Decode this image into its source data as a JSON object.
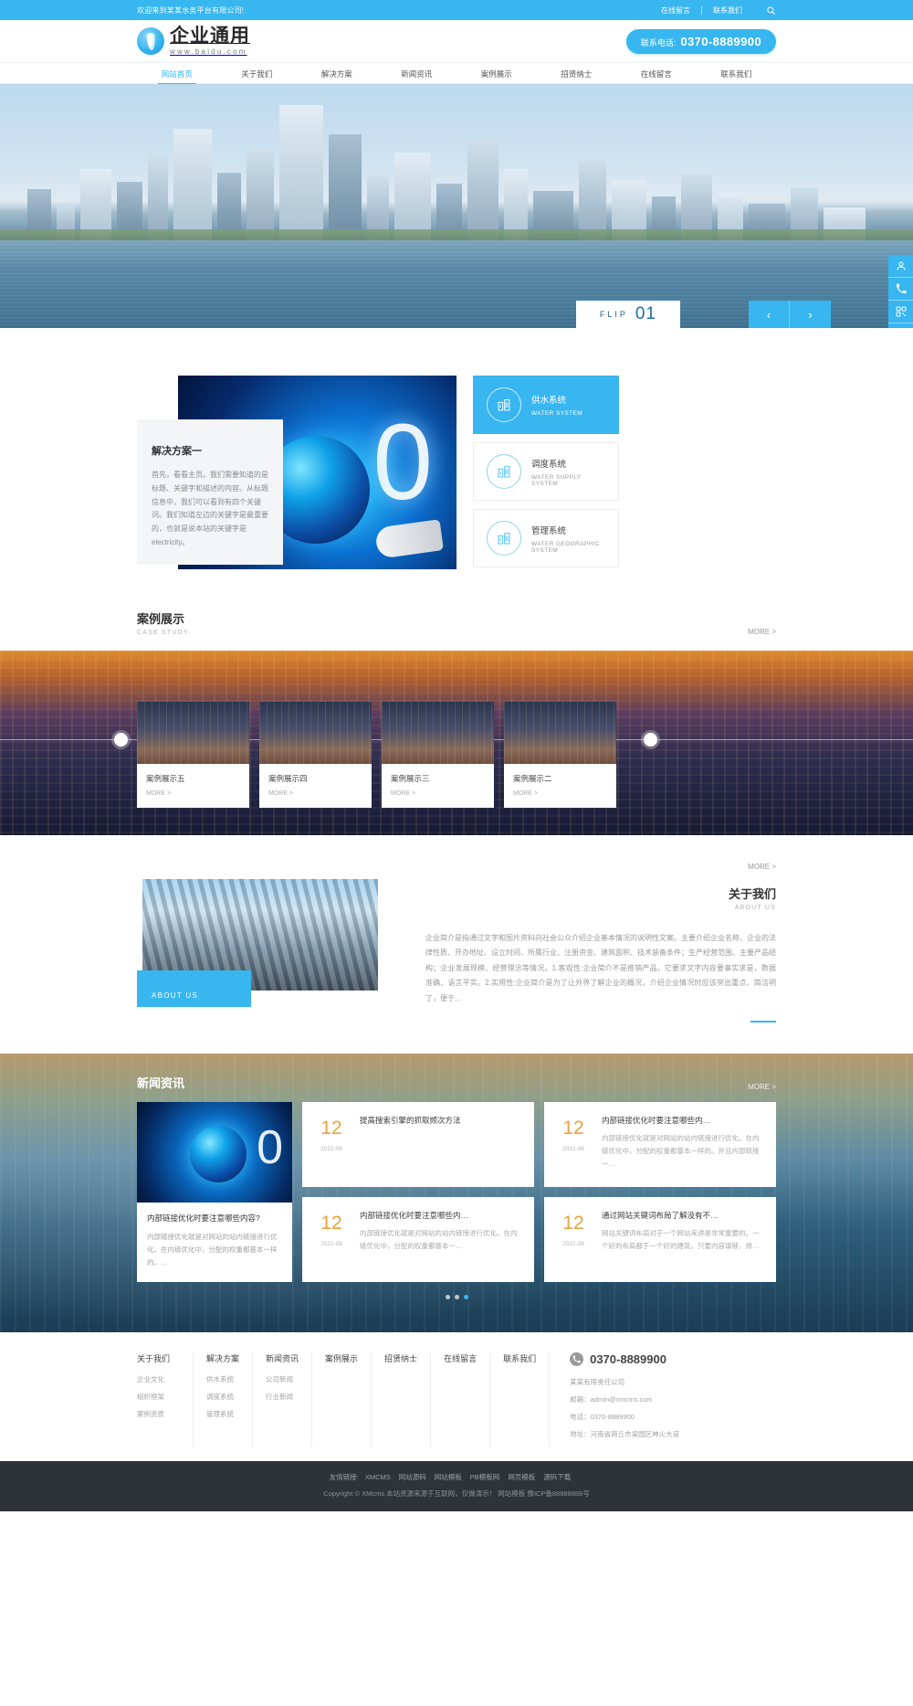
{
  "colors": {
    "accent": "#37b6ef",
    "orange": "#e8a33a",
    "footer_bg": "#2d3338"
  },
  "topbar": {
    "welcome": "欢迎来到某某水务平台有限公司!",
    "link_message": "在线留言",
    "link_contact": "联系我们",
    "search_icon": "search-icon"
  },
  "header": {
    "logo_cn": "企业通用",
    "logo_en": "www.baidu.com",
    "tel_label": "联系电话:",
    "tel_number": "0370-8889900"
  },
  "nav": {
    "items": [
      {
        "label": "网站首页",
        "active": true
      },
      {
        "label": "关于我们",
        "active": false
      },
      {
        "label": "解决方案",
        "active": false
      },
      {
        "label": "新闻资讯",
        "active": false
      },
      {
        "label": "案例展示",
        "active": false
      },
      {
        "label": "招贤纳士",
        "active": false
      },
      {
        "label": "在线留言",
        "active": false
      },
      {
        "label": "联系我们",
        "active": false
      }
    ]
  },
  "banner": {
    "flip_word": "FLIP",
    "flip_num": "01",
    "prev": "‹",
    "next": "›"
  },
  "rail": {
    "items": [
      {
        "icon": "user-service-icon"
      },
      {
        "icon": "phone-icon"
      },
      {
        "icon": "qrcode-icon"
      },
      {
        "icon": "back-to-top-icon"
      }
    ]
  },
  "solution": {
    "card_title": "解决方案一",
    "card_text": "首先，看看主页。我们需要知道的是标题、关键字和描述的内容。从标题信息中，我们可以看到有四个关键词。我们知道左边的关键字是最重要的，也就是说本站的关键字是electricity。",
    "items": [
      {
        "name": "供水系统",
        "en": "WATER SYSTEM",
        "active": true,
        "icon": "building-icon"
      },
      {
        "name": "调度系统",
        "en": "WATER SUPPLY SYSTEM",
        "active": false,
        "icon": "building-icon"
      },
      {
        "name": "管理系统",
        "en": "WATER GEOGRAPHIC SYSTEM",
        "active": false,
        "icon": "building-icon"
      }
    ]
  },
  "cases": {
    "title": "案例展示",
    "subtitle": "CASE STUDY",
    "more": "MORE >",
    "items": [
      {
        "name": "案例展示五",
        "more": "MORE >"
      },
      {
        "name": "案例展示四",
        "more": "MORE >"
      },
      {
        "name": "案例展示三",
        "more": "MORE >"
      },
      {
        "name": "案例展示二",
        "more": "MORE >"
      }
    ]
  },
  "about": {
    "more": "MORE >",
    "title": "关于我们",
    "subtitle": "ABOUT US",
    "badge": "ABOUT US",
    "text": "企业简介是指通过文字和图片资料向社会公众介绍企业基本情况的说明性文案。主要介绍企业名称、企业的法律性质、开办地址、设立时间、所属行业、注册资金、建筑面积、技术装备条件；生产经营范围、主要产品结构；企业发展规模、经营理念等情况。1.客观性:企业简介不是推销产品，它要求文字内容要事实求是，数据准确、语言平实。2.实用性:企业简介是为了让外界了解企业的概况，介绍企业情况时应该突出重点、简洁明了，便于…"
  },
  "news": {
    "title": "新闻资讯",
    "more": "MORE >",
    "feature": {
      "title": "内部链接优化时要注意哪些内容?",
      "desc": "内部链接优化就是对网站的站内链接进行优化。在内链优化中，分配的权重都基本一样的。…"
    },
    "items": [
      {
        "day": "12",
        "ym": "2022-08",
        "title": "提高搜索引擎的抓取频次方法",
        "desc": ""
      },
      {
        "day": "12",
        "ym": "2022-08",
        "title": "内部链接优化时要注意哪些内…",
        "desc": "内部链接优化就是对网站的站内链接进行优化。在内链优化中，分配的权重都基本一样的。并且内部链接一…"
      },
      {
        "day": "12",
        "ym": "2022-08",
        "title": "内部链接优化时要注意哪些内…",
        "desc": "内部链接优化就是对网站的站内链接进行优化。在内链优化中，分配的权重都基本一…"
      },
      {
        "day": "12",
        "ym": "2022-08",
        "title": "通过网站关键词布局了解没有不…",
        "desc": "网站关键词布局对于一个网站来讲是非常重要的。一个好的布局都于一个好的建筑，只要内容填够，排…"
      }
    ],
    "dots": [
      false,
      false,
      true
    ]
  },
  "footer": {
    "columns": [
      {
        "title": "关于我们",
        "links": [
          "企业文化",
          "组织框架",
          "案例资质"
        ]
      },
      {
        "title": "解决方案",
        "links": [
          "供水系统",
          "调度系统",
          "管理系统"
        ]
      },
      {
        "title": "新闻资讯",
        "links": [
          "公司新闻",
          "行业新闻"
        ]
      },
      {
        "title": "案例展示",
        "links": []
      },
      {
        "title": "招贤纳士",
        "links": []
      },
      {
        "title": "在线留言",
        "links": []
      },
      {
        "title": "联系我们",
        "links": []
      }
    ],
    "contact": {
      "phone_icon": "phone-icon",
      "phone": "0370-8889900",
      "company": "某某有限责任公司",
      "email": "邮箱：admin@xmcms.com",
      "tel": "电话：0370-8889900",
      "address": "地址：河南省商丘市梁园区神火大道"
    }
  },
  "bottom": {
    "friend_label": "友情链接:",
    "friend_links": [
      "XMCMS",
      "网站源码",
      "网站模板",
      "PB模板网",
      "网页模板",
      "源码下载"
    ],
    "copyright": "Copyright © XMcms 本站资源来源于互联网，仅做演示！",
    "template": "网站模板",
    "icp": "豫ICP备88888888号"
  }
}
